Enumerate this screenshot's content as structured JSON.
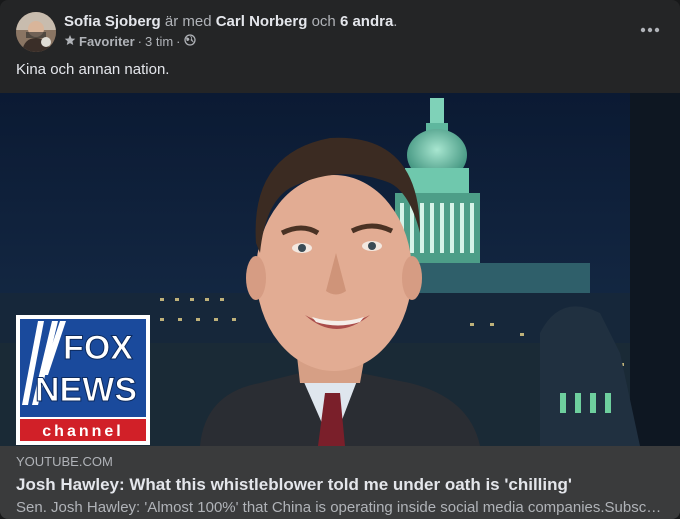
{
  "post": {
    "author": "Sofia Sjoberg",
    "with_text": "är med",
    "tagged": "Carl Norberg",
    "and_text": "och",
    "others": "6 andra",
    "period": ".",
    "audience": "Favoriter",
    "separator": "·",
    "time": "3 tim",
    "separator2": "·",
    "text": "Kina och annan nation."
  },
  "media": {
    "logo_line1": "FOX",
    "logo_line2": "NEWS",
    "logo_line3": "channel"
  },
  "link": {
    "domain": "YOUTUBE.COM",
    "title": "Josh Hawley: What this whistleblower told me under oath is 'chilling'",
    "description": "Sen. Josh Hawley: 'Almost 100%' that China is operating inside social media companies.Subscribe to Fox News!"
  },
  "colors": {
    "card_bg": "#242526",
    "link_bg": "#3a3b3c",
    "fox_blue": "#1a4a9c",
    "fox_red": "#d12028"
  },
  "icons": {
    "more": "more-horizontal-icon",
    "star": "star-icon",
    "globe": "globe-icon"
  }
}
